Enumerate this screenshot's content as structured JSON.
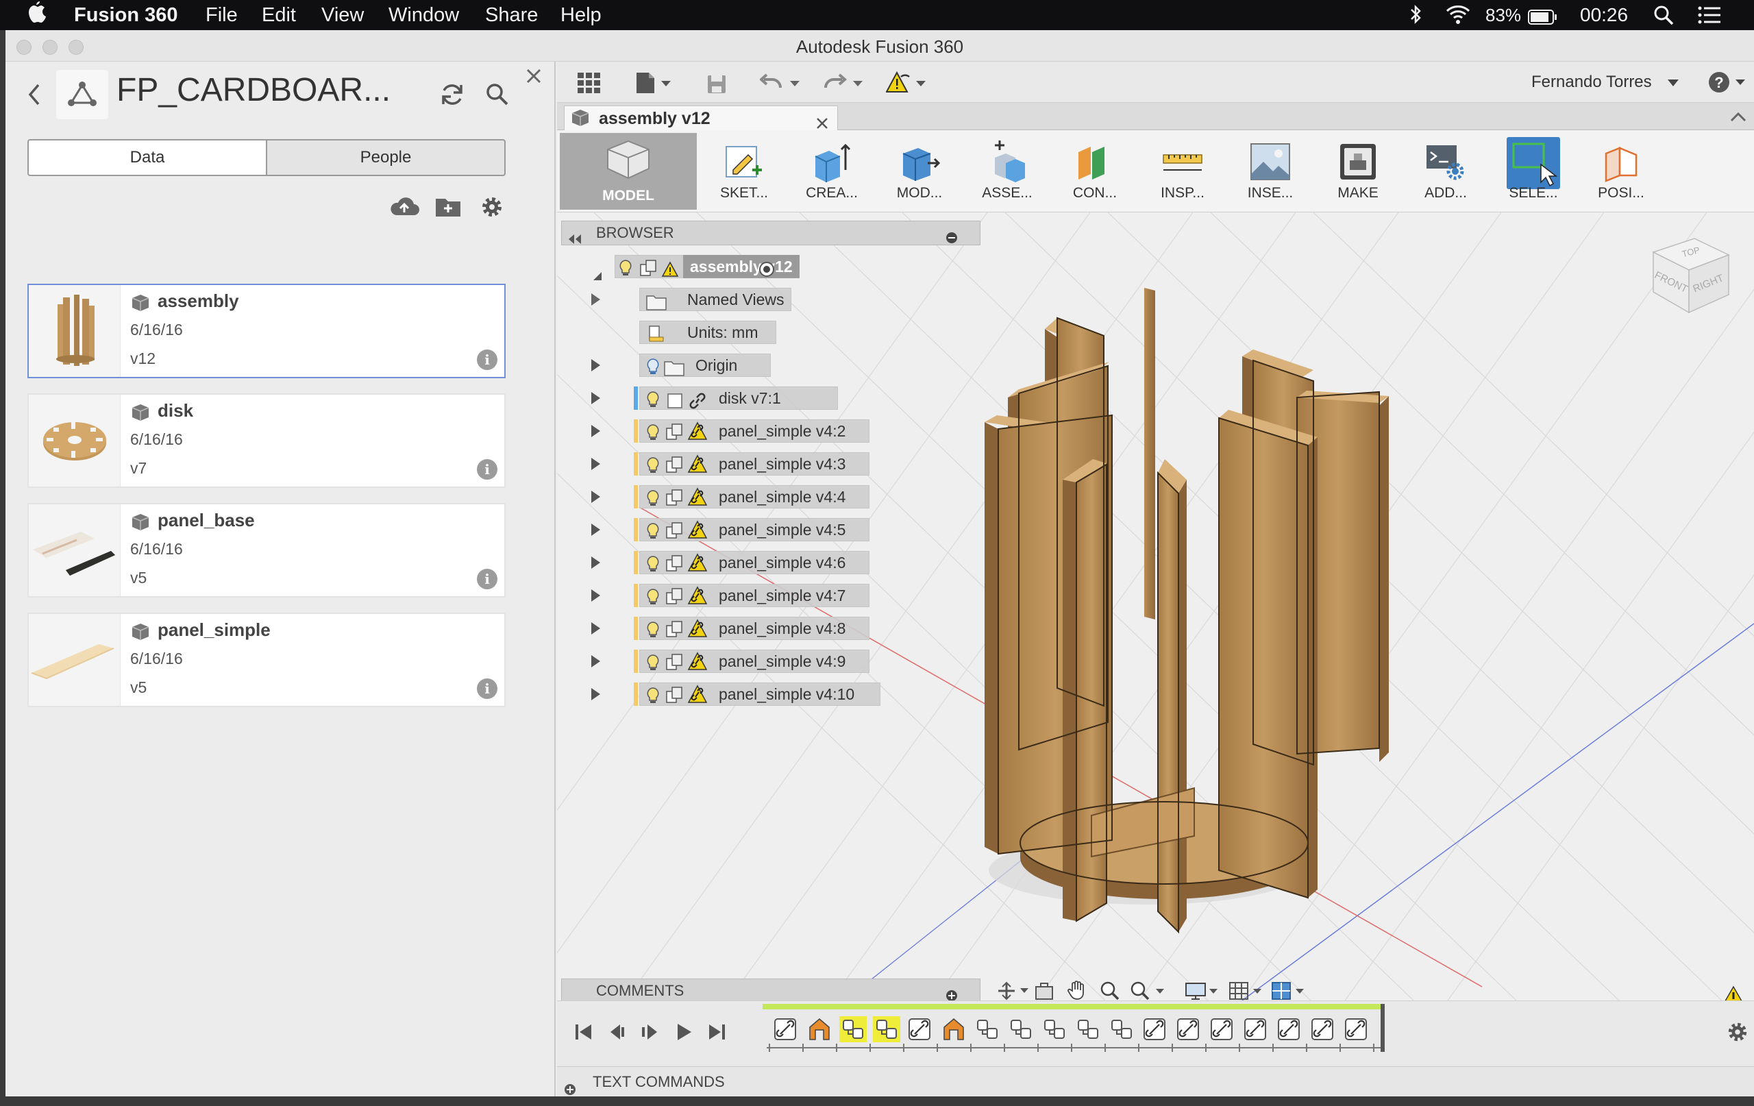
{
  "menubar": {
    "app_name": "Fusion 360",
    "menus": [
      "File",
      "Edit",
      "View",
      "Window",
      "Share",
      "Help"
    ],
    "battery": "83%",
    "clock": "00:26"
  },
  "window": {
    "title": "Autodesk Fusion 360"
  },
  "data_panel": {
    "project_title": "FP_CARDBOAR...",
    "tabs": [
      "Data",
      "People"
    ],
    "active_tab": "Data",
    "files": [
      {
        "name": "assembly",
        "date": "6/16/16",
        "version": "v12"
      },
      {
        "name": "disk",
        "date": "6/16/16",
        "version": "v7"
      },
      {
        "name": "panel_base",
        "date": "6/16/16",
        "version": "v5"
      },
      {
        "name": "panel_simple",
        "date": "6/16/16",
        "version": "v5"
      }
    ]
  },
  "toolbar": {
    "user_name": "Fernando Torres"
  },
  "document_tab": {
    "label": "assembly v12"
  },
  "ribbon": {
    "workspace": "MODEL",
    "groups": [
      "SKET...",
      "CREA...",
      "MOD...",
      "ASSE...",
      "CON...",
      "INSP...",
      "INSE...",
      "MAKE",
      "ADD...",
      "SELE...",
      "POSI..."
    ]
  },
  "browser": {
    "header": "BROWSER",
    "root": "assembly v12",
    "items": [
      {
        "label": "Named Views"
      },
      {
        "label": "Units: mm"
      },
      {
        "label": "Origin"
      },
      {
        "label": "disk v7:1"
      },
      {
        "label": "panel_simple v4:2"
      },
      {
        "label": "panel_simple v4:3"
      },
      {
        "label": "panel_simple v4:4"
      },
      {
        "label": "panel_simple v4:5"
      },
      {
        "label": "panel_simple v4:6"
      },
      {
        "label": "panel_simple v4:7"
      },
      {
        "label": "panel_simple v4:8"
      },
      {
        "label": "panel_simple v4:9"
      },
      {
        "label": "panel_simple v4:10"
      }
    ]
  },
  "viewcube": {
    "top": "TOP",
    "front": "FRONT",
    "right": "RIGHT"
  },
  "comments": {
    "header": "COMMENTS"
  },
  "text_commands": {
    "label": "TEXT COMMANDS"
  }
}
